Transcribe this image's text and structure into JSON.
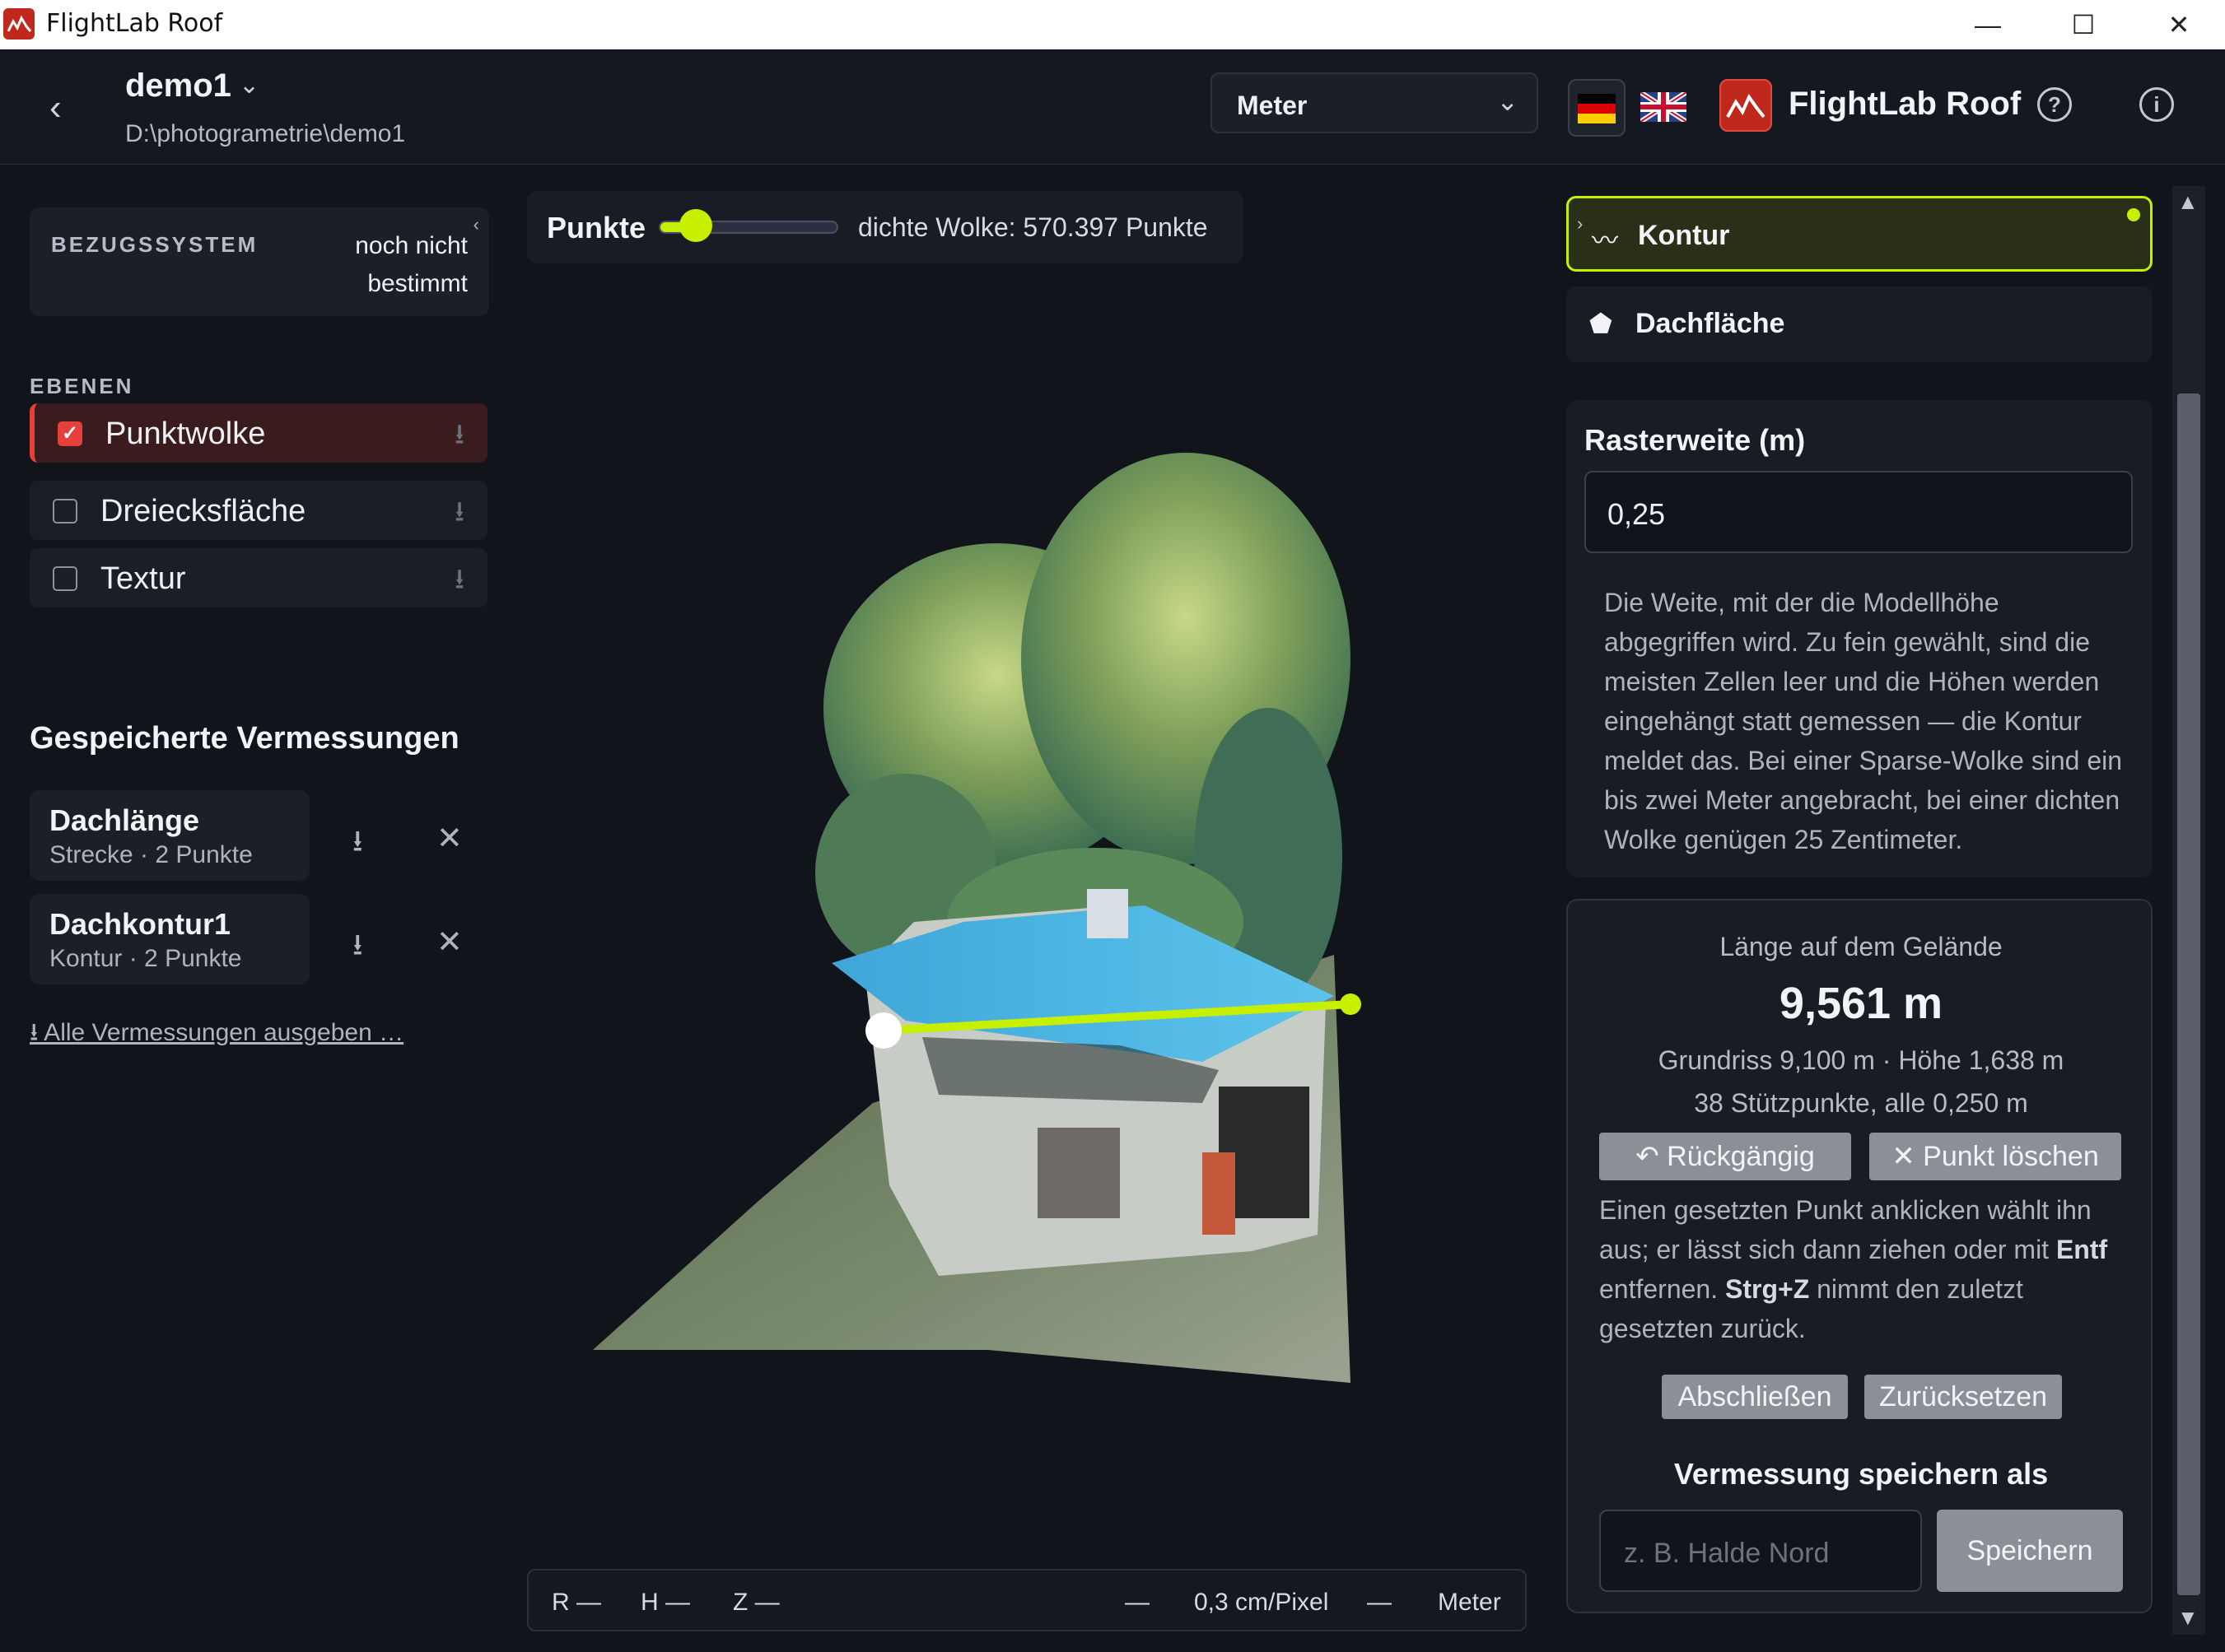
{
  "window": {
    "title": "FlightLab Roof",
    "minimize": "—",
    "maximize": "☐",
    "close": "✕"
  },
  "header": {
    "back": "‹",
    "project_name": "demo1",
    "project_path": "D:\\photogrametrie\\demo1",
    "unit_select": "Meter",
    "brand": "FlightLab Roof",
    "help_icon": "?",
    "info_icon": "i"
  },
  "sidebar": {
    "ref_label": "BEZUGSSYSTEM",
    "ref_value": "noch nicht bestimmt",
    "layers_label": "EBENEN",
    "layers": [
      {
        "label": "Punktwolke",
        "checked": true
      },
      {
        "label": "Dreiecksfläche",
        "checked": false
      },
      {
        "label": "Textur",
        "checked": false
      }
    ],
    "saved_title": "Gespeicherte Vermessungen",
    "saved": [
      {
        "name": "Dachlänge",
        "detail": "Strecke · 2 Punkte"
      },
      {
        "name": "Dachkontur1",
        "detail": "Kontur · 2 Punkte"
      }
    ],
    "export_all": "⭳ Alle Vermessungen ausgeben …"
  },
  "viewer": {
    "points_label": "Punkte",
    "point_size_fraction": 0.14,
    "cloud_info": "dichte Wolke: 570.397 Punkte",
    "status": {
      "r": "R —",
      "h": "H —",
      "z": "Z —",
      "dash1": "—",
      "scale": "0,3 cm/Pixel",
      "dash2": "—",
      "unit": "Meter"
    }
  },
  "tools": {
    "kontur": {
      "icon": "〰",
      "label": "Kontur",
      "active": true
    },
    "dachflaeche": {
      "icon": "⬟",
      "label": "Dachfläche",
      "active": false
    }
  },
  "raster": {
    "heading": "Rasterweite (m)",
    "value": "0,25",
    "help": "Die Weite, mit der die Modellhöhe abgegriffen wird. Zu fein gewählt, sind die meisten Zellen leer und die Höhen werden eingehängt statt gemessen — die Kontur meldet das. Bei einer Sparse-Wolke sind ein bis zwei Meter angebracht, bei einer dichten Wolke genügen 25 Zentimeter."
  },
  "result": {
    "caption": "Länge auf dem Gelände",
    "length": "9,561 m",
    "detail1": "Grundriss 9,100 m · Höhe 1,638 m",
    "detail2": "38 Stützpunkte, alle 0,250 m",
    "undo": "↶ Rückgängig",
    "delete_point": "✕ Punkt löschen",
    "help_a": "Einen gesetzten Punkt anklicken wählt ihn aus; er lässt sich dann ziehen oder mit ",
    "help_key1": "Entf",
    "help_b": " entfernen. ",
    "help_key2": "Strg+Z",
    "help_c": " nimmt den zuletzt gesetzten zurück.",
    "finish": "Abschließen",
    "reset": "Zurücksetzen",
    "save_title": "Vermessung speichern als",
    "save_placeholder": "z. B. Halde Nord",
    "save_button": "Speichern"
  },
  "colors": {
    "accent": "#c7f000",
    "danger": "#e5413a",
    "brand": "#c0281e"
  }
}
